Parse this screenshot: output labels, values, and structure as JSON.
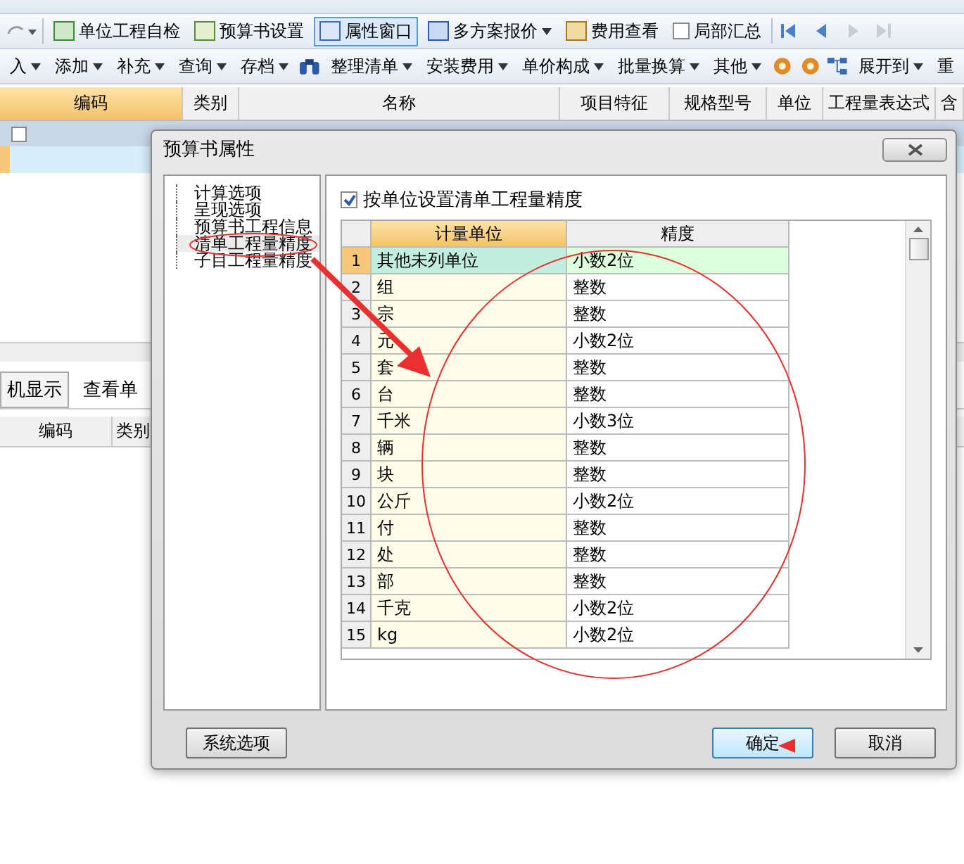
{
  "toolbar_1": [
    {
      "kind": "button",
      "label": "单位工程自检",
      "selected": false
    },
    {
      "kind": "button",
      "label": "预算书设置",
      "selected": false
    },
    {
      "kind": "button",
      "label": "属性窗口",
      "selected": true
    },
    {
      "kind": "menu",
      "label": "多方案报价",
      "selected": false
    },
    {
      "kind": "button",
      "label": "费用查看",
      "selected": false
    },
    {
      "kind": "checkbox",
      "label": "局部汇总",
      "checked": false
    }
  ],
  "toolbar_2": [
    {
      "kind": "menu",
      "label": "入"
    },
    {
      "kind": "menu",
      "label": "添加"
    },
    {
      "kind": "menu",
      "label": "补充"
    },
    {
      "kind": "menu",
      "label": "查询"
    },
    {
      "kind": "menu",
      "label": "存档"
    },
    {
      "kind": "binoculars"
    },
    {
      "kind": "menu",
      "label": "整理清单"
    },
    {
      "kind": "menu",
      "label": "安装费用"
    },
    {
      "kind": "menu",
      "label": "单价构成"
    },
    {
      "kind": "menu",
      "label": "批量换算"
    },
    {
      "kind": "menu",
      "label": "其他"
    },
    {
      "kind": "tool"
    },
    {
      "kind": "tool"
    },
    {
      "kind": "tree"
    },
    {
      "kind": "menu",
      "label": "展开到"
    },
    {
      "kind": "text",
      "label": "重"
    }
  ],
  "main_grid": {
    "columns": [
      {
        "label": "编码",
        "selected": true
      },
      {
        "label": "类别",
        "selected": false
      },
      {
        "label": "名称",
        "selected": false
      },
      {
        "label": "项目特征",
        "selected": false
      },
      {
        "label": "规格型号",
        "selected": false
      },
      {
        "label": "单位",
        "selected": false
      },
      {
        "label": "工程量表达式",
        "selected": false
      },
      {
        "label": "含",
        "selected": false
      }
    ]
  },
  "lower_panel": {
    "tabs": [
      {
        "label": "机显示",
        "selected": true
      },
      {
        "label": "查看单",
        "selected": false
      }
    ],
    "columns": [
      "编码",
      "类别"
    ]
  },
  "dialog": {
    "title": "预算书属性",
    "tree": [
      {
        "label": "计算选项",
        "selected": false
      },
      {
        "label": "呈现选项",
        "selected": false
      },
      {
        "label": "预算书工程信息",
        "selected": false
      },
      {
        "label": "清单工程量精度",
        "selected": true
      },
      {
        "label": "子目工程量精度",
        "selected": false
      }
    ],
    "option": {
      "label": "按单位设置清单工程量精度",
      "checked": true
    },
    "table": {
      "columns": [
        "计量单位",
        "精度"
      ],
      "rows": [
        {
          "n": "1",
          "unit": "其他未列单位",
          "precision": "小数2位",
          "selected": true
        },
        {
          "n": "2",
          "unit": "组",
          "precision": "整数",
          "selected": false
        },
        {
          "n": "3",
          "unit": "宗",
          "precision": "整数",
          "selected": false
        },
        {
          "n": "4",
          "unit": "元",
          "precision": "小数2位",
          "selected": false
        },
        {
          "n": "5",
          "unit": "套",
          "precision": "整数",
          "selected": false
        },
        {
          "n": "6",
          "unit": "台",
          "precision": "整数",
          "selected": false
        },
        {
          "n": "7",
          "unit": "千米",
          "precision": "小数3位",
          "selected": false
        },
        {
          "n": "8",
          "unit": "辆",
          "precision": "整数",
          "selected": false
        },
        {
          "n": "9",
          "unit": "块",
          "precision": "整数",
          "selected": false
        },
        {
          "n": "10",
          "unit": "公斤",
          "precision": "小数2位",
          "selected": false
        },
        {
          "n": "11",
          "unit": "付",
          "precision": "整数",
          "selected": false
        },
        {
          "n": "12",
          "unit": "处",
          "precision": "整数",
          "selected": false
        },
        {
          "n": "13",
          "unit": "部",
          "precision": "整数",
          "selected": false
        },
        {
          "n": "14",
          "unit": "千克",
          "precision": "小数2位",
          "selected": false
        },
        {
          "n": "15",
          "unit": "kg",
          "precision": "小数2位",
          "selected": false
        }
      ]
    },
    "buttons": [
      {
        "kind": "secondary",
        "label": "系统选项"
      },
      {
        "kind": "primary",
        "label": "确定"
      },
      {
        "kind": "cancel",
        "label": "取消"
      }
    ]
  }
}
